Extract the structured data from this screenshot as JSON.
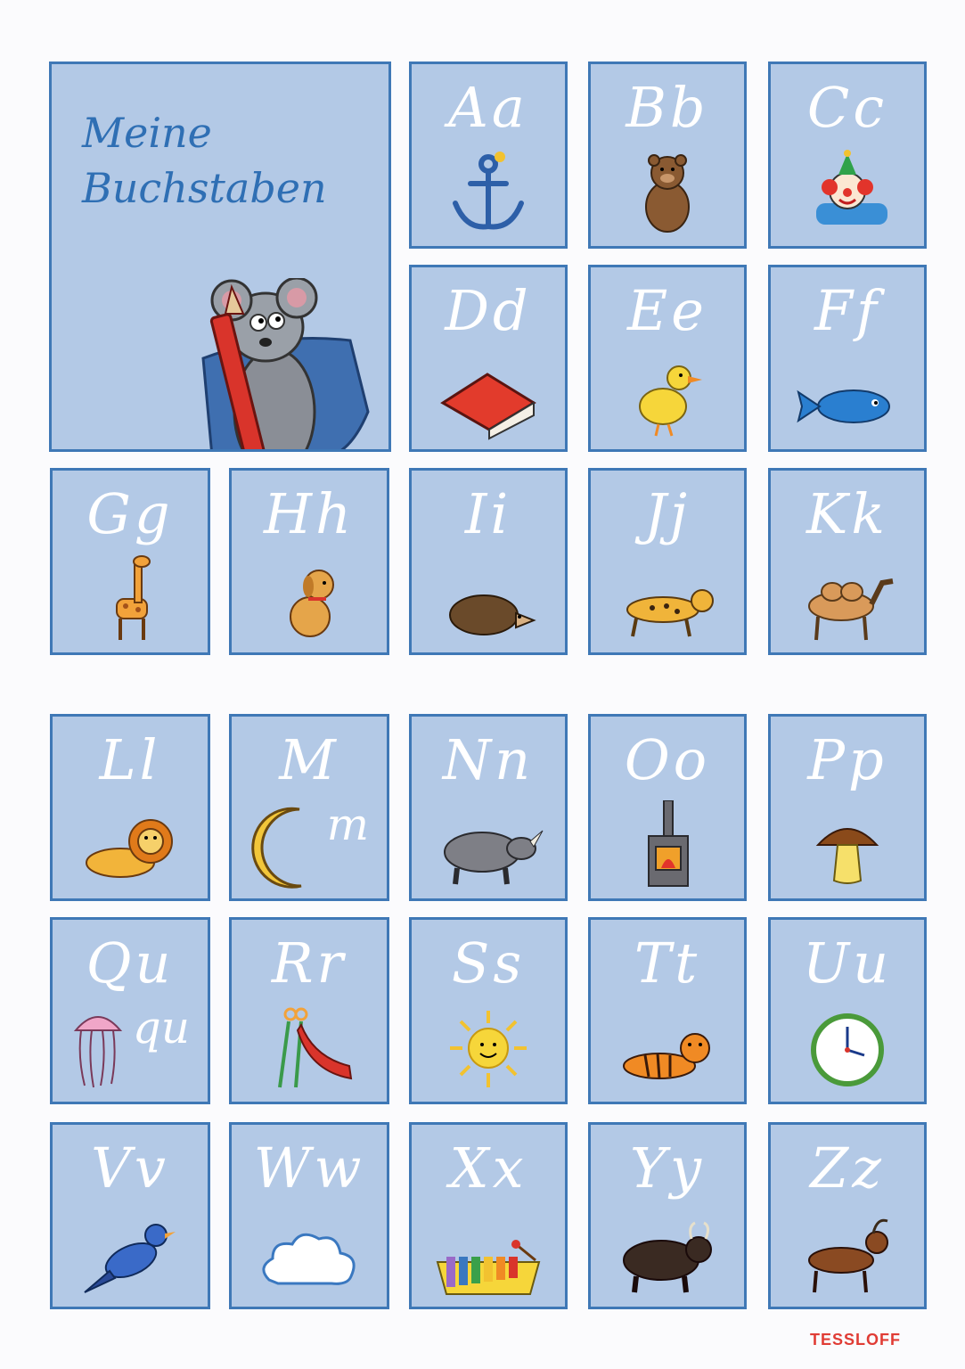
{
  "title": {
    "line1": "Meine",
    "line2": "Buchstaben"
  },
  "brand": "TESSLOFF",
  "cards": [
    {
      "id": "a",
      "letters": "Aa",
      "icon": "anchor-icon"
    },
    {
      "id": "b",
      "letters": "Bb",
      "icon": "bear-icon"
    },
    {
      "id": "c",
      "letters": "Cc",
      "icon": "clown-icon"
    },
    {
      "id": "d",
      "letters": "Dd",
      "icon": "roof-icon"
    },
    {
      "id": "e",
      "letters": "Ee",
      "icon": "duck-icon"
    },
    {
      "id": "f",
      "letters": "Ff",
      "icon": "fish-icon"
    },
    {
      "id": "g",
      "letters": "Gg",
      "icon": "giraffe-icon"
    },
    {
      "id": "h",
      "letters": "Hh",
      "icon": "dog-icon"
    },
    {
      "id": "i",
      "letters": "Ii",
      "icon": "hedgehog-icon"
    },
    {
      "id": "j",
      "letters": "Jj",
      "icon": "jaguar-icon"
    },
    {
      "id": "k",
      "letters": "Kk",
      "icon": "camel-icon"
    },
    {
      "id": "l",
      "letters": "Ll",
      "icon": "lion-icon"
    },
    {
      "id": "m",
      "letters": "M",
      "extra": "m",
      "icon": "moon-icon"
    },
    {
      "id": "n",
      "letters": "Nn",
      "icon": "rhino-icon"
    },
    {
      "id": "o",
      "letters": "Oo",
      "icon": "stove-icon"
    },
    {
      "id": "p",
      "letters": "Pp",
      "icon": "mushroom-icon"
    },
    {
      "id": "q",
      "letters": "Qu",
      "extra": "qu",
      "icon": "jellyfish-icon"
    },
    {
      "id": "r",
      "letters": "Rr",
      "icon": "slide-icon"
    },
    {
      "id": "s",
      "letters": "Ss",
      "icon": "sun-icon"
    },
    {
      "id": "t",
      "letters": "Tt",
      "icon": "tiger-icon"
    },
    {
      "id": "u",
      "letters": "Uu",
      "icon": "clock-icon"
    },
    {
      "id": "v",
      "letters": "Vv",
      "icon": "bird-icon"
    },
    {
      "id": "w",
      "letters": "Ww",
      "icon": "cloud-icon"
    },
    {
      "id": "x",
      "letters": "Xx",
      "icon": "xylophone-icon"
    },
    {
      "id": "y",
      "letters": "Yy",
      "icon": "yak-icon"
    },
    {
      "id": "z",
      "letters": "Zz",
      "icon": "goat-icon"
    }
  ],
  "colors": {
    "card_fill": "#b3c9e6",
    "card_border": "#3f78b6",
    "title_text": "#2f6fb4",
    "letter_text": "#ffffff",
    "brand_text": "#e03c35",
    "page_background": "#fbfbfd"
  }
}
